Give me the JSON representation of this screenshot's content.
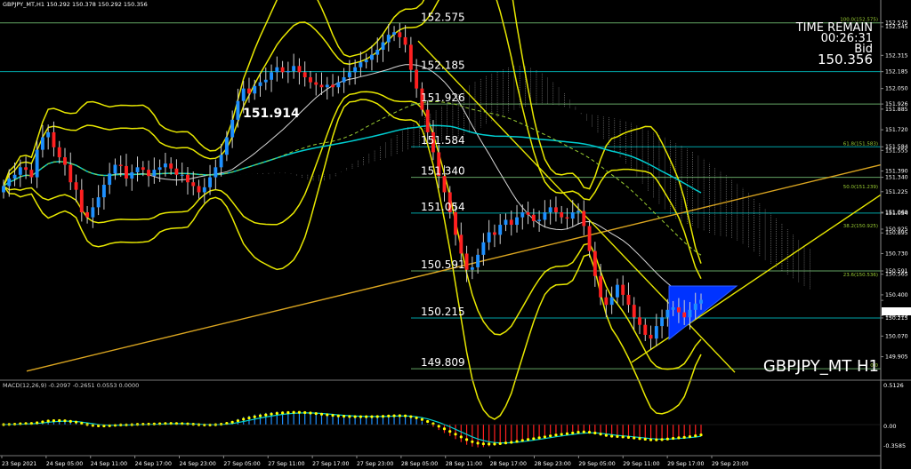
{
  "header": {
    "title": "GBPJPY_MT,H1  150.292 150.378 150.292 150.356"
  },
  "info": {
    "time_remain_label": "TIME REMAIN",
    "time_remain": "00:26:31",
    "bid_label": "Bid",
    "bid": "150.356"
  },
  "watermark": "GBPJPY_MT H1",
  "highlight_label": "151.914",
  "colors": {
    "background": "#000000",
    "bull": "#1E90FF",
    "bear": "#FF2020",
    "band": "#E8E800",
    "level": "#7CCD7C",
    "ma": "#00CED1",
    "fibo": "#9ACD32",
    "trend": "#DAA520"
  },
  "indicator": {
    "title": "MACD(12,26,9)  -0.2097 -0.2651 0.0553 0.0000",
    "scale": [
      "0.5126",
      "0.00",
      "-0.3585"
    ]
  },
  "chart_data": {
    "type": "candlestick",
    "title": "GBPJPY_MT,H1",
    "xlabel": "",
    "ylabel": "",
    "ylim": [
      149.76,
      152.63
    ],
    "price_levels": [
      "152.575",
      "152.185",
      "151.926",
      "151.584",
      "151.340",
      "151.054",
      "150.591",
      "150.215",
      "149.809"
    ],
    "fibo_levels": [
      "100.0(152.575)",
      "61.8(151.583)",
      "50.0(151.239)",
      "38.2(150.925)",
      "23.6(150.536)",
      "0.0"
    ],
    "y_ticks": [
      "152.575",
      "152.545",
      "152.315",
      "152.185",
      "152.050",
      "151.926",
      "151.885",
      "151.720",
      "151.584",
      "151.555",
      "151.390",
      "151.340",
      "151.225",
      "151.054",
      "151.060",
      "150.925",
      "150.895",
      "150.730",
      "150.591",
      "150.565",
      "150.400",
      "150.356",
      "150.235",
      "150.215",
      "150.070",
      "149.905"
    ],
    "x_ticks": [
      "23 Sep 2021",
      "24 Sep 05:00",
      "24 Sep 11:00",
      "24 Sep 17:00",
      "24 Sep 23:00",
      "27 Sep 05:00",
      "27 Sep 11:00",
      "27 Sep 17:00",
      "27 Sep 23:00",
      "28 Sep 05:00",
      "28 Sep 11:00",
      "28 Sep 17:00",
      "28 Sep 23:00",
      "29 Sep 05:00",
      "29 Sep 11:00",
      "29 Sep 17:00",
      "29 Sep 23:00"
    ],
    "close": [
      151.27,
      151.33,
      151.36,
      151.42,
      151.4,
      151.34,
      151.56,
      151.66,
      151.7,
      151.58,
      151.5,
      151.44,
      151.3,
      151.24,
      151.06,
      151.02,
      151.1,
      151.18,
      151.28,
      151.37,
      151.44,
      151.43,
      151.33,
      151.38,
      151.42,
      151.4,
      151.35,
      151.4,
      151.42,
      151.45,
      151.41,
      151.36,
      151.36,
      151.3,
      151.27,
      151.22,
      151.26,
      151.34,
      151.42,
      151.52,
      151.66,
      151.8,
      151.95,
      152.05,
      152.01,
      152.07,
      152.1,
      152.12,
      152.18,
      152.22,
      152.18,
      152.19,
      152.23,
      152.18,
      152.14,
      152.1,
      152.08,
      152.06,
      152.08,
      152.06,
      152.1,
      152.14,
      152.18,
      152.22,
      152.26,
      152.28,
      152.32,
      152.36,
      152.42,
      152.48,
      152.5,
      152.46,
      152.4,
      152.2,
      152.05,
      151.88,
      151.7,
      151.54,
      151.35,
      151.22,
      151.06,
      150.88,
      150.73,
      150.6,
      150.62,
      150.72,
      150.82,
      150.9,
      150.88,
      150.96,
      151.0,
      150.96,
      151.02,
      151.06,
      151.04,
      150.99,
      151.0,
      151.06,
      151.1,
      151.06,
      151.02,
      151.01,
      151.06,
      151.07,
      150.95,
      150.75,
      150.55,
      150.38,
      150.32,
      150.38,
      150.48,
      150.4,
      150.32,
      150.22,
      150.16,
      150.08,
      150.05,
      150.15,
      150.22,
      150.28,
      150.3,
      150.26,
      150.22,
      150.28,
      150.33,
      150.36
    ],
    "series": [
      {
        "name": "Main window",
        "values": [
          151.27,
          151.33,
          151.36,
          151.42,
          151.4,
          151.34,
          151.56,
          151.66,
          151.7,
          151.58,
          151.5,
          151.44,
          151.3,
          151.24,
          151.06,
          151.02,
          151.1,
          151.18,
          151.28,
          151.37,
          151.44,
          151.43,
          151.33,
          151.38,
          151.42,
          151.4,
          151.35,
          151.4,
          151.42,
          151.45,
          151.41,
          151.36,
          151.36,
          151.3,
          151.27,
          151.22,
          151.26,
          151.34,
          151.42,
          151.52,
          151.66,
          151.8,
          151.95,
          152.05,
          152.01,
          152.07,
          152.1,
          152.12,
          152.18,
          152.22,
          152.18,
          152.19,
          152.23,
          152.18,
          152.14,
          152.1,
          152.08,
          152.06,
          152.08,
          152.06,
          152.1,
          152.14,
          152.18,
          152.22,
          152.26,
          152.28,
          152.32,
          152.36,
          152.42,
          152.48,
          152.5,
          152.46,
          152.4,
          152.2,
          152.05,
          151.88,
          151.7,
          151.54,
          151.35,
          151.22,
          151.06,
          150.88,
          150.73,
          150.6,
          150.62,
          150.72,
          150.82,
          150.9,
          150.88,
          150.96,
          151.0,
          150.96,
          151.02,
          151.06,
          151.04,
          150.99,
          151.0,
          151.06,
          151.1,
          151.06,
          151.02,
          151.01,
          151.06,
          151.07,
          150.95,
          150.75,
          150.55,
          150.38,
          150.32,
          150.38,
          150.48,
          150.4,
          150.32,
          150.22,
          150.16,
          150.08,
          150.05,
          150.15,
          150.22,
          150.28,
          150.3,
          150.26,
          150.22,
          150.28,
          150.33,
          150.36
        ]
      }
    ],
    "grid": false,
    "legend": "none"
  }
}
